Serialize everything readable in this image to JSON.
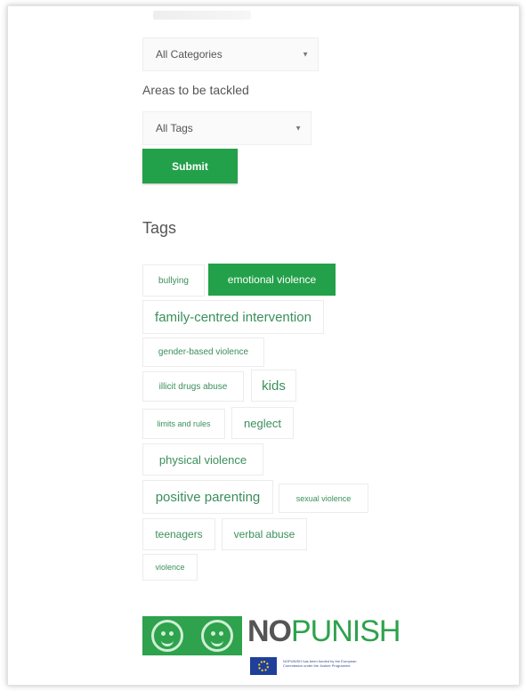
{
  "category_select": {
    "value": "All Categories"
  },
  "area_label": "Areas to be tackled",
  "tag_select": {
    "value": "All Tags"
  },
  "submit_label": "Submit",
  "tags_heading": "Tags",
  "tags": [
    "bullying",
    "emotional violence",
    "family-centred intervention",
    "gender-based violence",
    "illicit drugs abuse",
    "kids",
    "limits and rules",
    "neglect",
    "physical violence",
    "positive parenting",
    "sexual violence",
    "teenagers",
    "verbal abuse",
    "violence"
  ],
  "active_tag": "emotional violence",
  "logo": {
    "no": "NO",
    "punish": "PUNISH",
    "eu_text": "NOPUNISH has been funded by the European Commission under the Justice Programme"
  },
  "colors": {
    "accent": "#23a04a",
    "tag_text": "#3a8f5b"
  }
}
